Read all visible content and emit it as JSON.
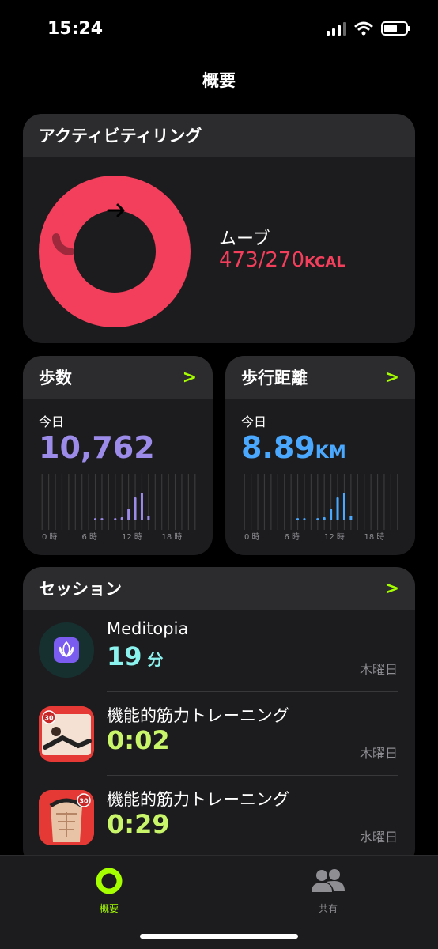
{
  "status": {
    "time": "15:24"
  },
  "nav": {
    "title": "概要"
  },
  "activity": {
    "title": "アクティビティリング",
    "move_label": "ムーブ",
    "move_value": "473/270",
    "move_unit": "KCAL",
    "move_progress": 1.75,
    "ring_color": "#f33f5c"
  },
  "steps": {
    "title": "歩数",
    "today_label": "今日",
    "value": "10,762",
    "color": "#9d8bea",
    "hour_labels": [
      "0 時",
      "6 時",
      "12 時",
      "18 時"
    ],
    "bars": [
      0,
      0,
      0,
      0,
      0,
      0,
      0,
      0,
      0.05,
      0.05,
      0,
      0.05,
      0.07,
      0.25,
      0.5,
      0.6,
      0.1,
      0,
      0,
      0,
      0,
      0,
      0,
      0
    ]
  },
  "distance": {
    "title": "歩行距離",
    "today_label": "今日",
    "value": "8.89",
    "unit": "KM",
    "color": "#4aa8ff",
    "hour_labels": [
      "0 時",
      "6 時",
      "12 時",
      "18 時"
    ],
    "bars": [
      0,
      0,
      0,
      0,
      0,
      0,
      0,
      0,
      0.05,
      0.05,
      0,
      0.05,
      0.07,
      0.25,
      0.5,
      0.6,
      0.1,
      0,
      0,
      0,
      0,
      0,
      0,
      0
    ]
  },
  "sessions": {
    "title": "セッション",
    "items": [
      {
        "name": "Meditopia",
        "value": "19",
        "unit": " 分",
        "day": "木曜日",
        "color": "#8cf2ee"
      },
      {
        "name": "機能的筋力トレーニング",
        "value": "0:02",
        "unit": "",
        "day": "木曜日",
        "color": "#c8f56a"
      },
      {
        "name": "機能的筋力トレーニング",
        "value": "0:29",
        "unit": "",
        "day": "水曜日",
        "color": "#c8f56a"
      }
    ]
  },
  "tabbar": {
    "summary_label": "概要",
    "sharing_label": "共有",
    "active_color": "#a6ff00"
  }
}
